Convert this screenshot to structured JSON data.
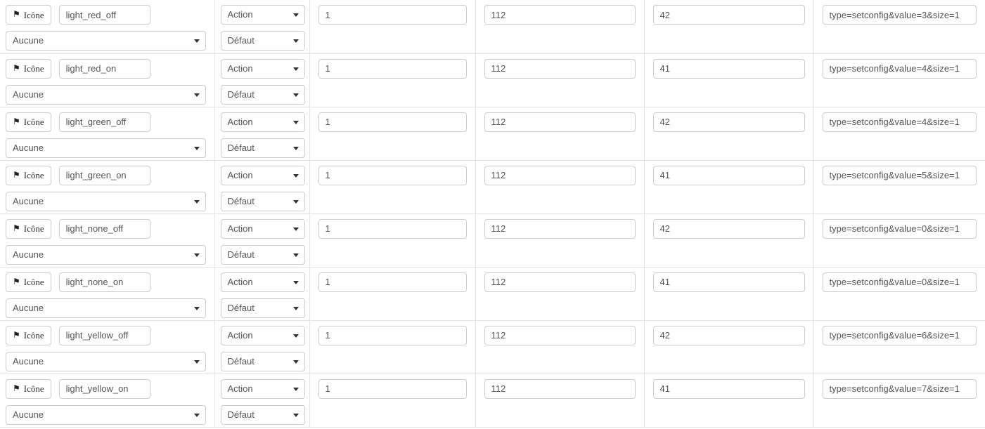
{
  "table": {
    "icon_button_label": "Icône",
    "icon_button_glyph": "⚑",
    "icon_select_label": "Aucune",
    "action_select_label": "Action",
    "default_select_label": "Défaut",
    "rows": [
      {
        "icon_button": "Icône",
        "name": "light_red_off",
        "icon_select": "Aucune",
        "action_select": "Action",
        "sub_select": "Défaut",
        "num1": "1",
        "num2": "112",
        "num3": "42",
        "params": "type=setconfig&value=3&size=1"
      },
      {
        "icon_button": "Icône",
        "name": "light_red_on",
        "icon_select": "Aucune",
        "action_select": "Action",
        "sub_select": "Défaut",
        "num1": "1",
        "num2": "112",
        "num3": "41",
        "params": "type=setconfig&value=4&size=1"
      },
      {
        "icon_button": "Icône",
        "name": "light_green_off",
        "icon_select": "Aucune",
        "action_select": "Action",
        "sub_select": "Défaut",
        "num1": "1",
        "num2": "112",
        "num3": "42",
        "params": "type=setconfig&value=4&size=1"
      },
      {
        "icon_button": "Icône",
        "name": "light_green_on",
        "icon_select": "Aucune",
        "action_select": "Action",
        "sub_select": "Défaut",
        "num1": "1",
        "num2": "112",
        "num3": "41",
        "params": "type=setconfig&value=5&size=1"
      },
      {
        "icon_button": "Icône",
        "name": "light_none_off",
        "icon_select": "Aucune",
        "action_select": "Action",
        "sub_select": "Défaut",
        "num1": "1",
        "num2": "112",
        "num3": "42",
        "params": "type=setconfig&value=0&size=1"
      },
      {
        "icon_button": "Icône",
        "name": "light_none_on",
        "icon_select": "Aucune",
        "action_select": "Action",
        "sub_select": "Défaut",
        "num1": "1",
        "num2": "112",
        "num3": "41",
        "params": "type=setconfig&value=0&size=1"
      },
      {
        "icon_button": "Icône",
        "name": "light_yellow_off",
        "icon_select": "Aucune",
        "action_select": "Action",
        "sub_select": "Défaut",
        "num1": "1",
        "num2": "112",
        "num3": "42",
        "params": "type=setconfig&value=6&size=1"
      },
      {
        "icon_button": "Icône",
        "name": "light_yellow_on",
        "icon_select": "Aucune",
        "action_select": "Action",
        "sub_select": "Défaut",
        "num1": "1",
        "num2": "112",
        "num3": "41",
        "params": "type=setconfig&value=7&size=1"
      }
    ]
  },
  "colors": {
    "border": "#e5e5e5",
    "control_border": "#cccccc",
    "text": "#555555",
    "background": "#ffffff"
  }
}
